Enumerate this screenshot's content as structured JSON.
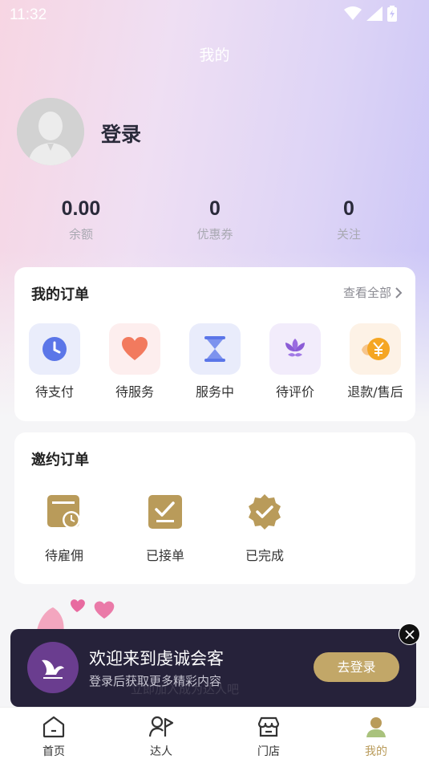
{
  "status_bar": {
    "time": "11:32"
  },
  "header": {
    "title": "我的"
  },
  "profile": {
    "login_label": "登录"
  },
  "stats": [
    {
      "value": "0.00",
      "label": "余额"
    },
    {
      "value": "0",
      "label": "优惠券"
    },
    {
      "value": "0",
      "label": "关注"
    }
  ],
  "my_orders": {
    "title": "我的订单",
    "view_all": "查看全部",
    "items": [
      {
        "label": "待支付",
        "icon": "clock-icon",
        "bg": "#eaedfb"
      },
      {
        "label": "待服务",
        "icon": "heart-icon",
        "bg": "#fdeeee"
      },
      {
        "label": "服务中",
        "icon": "hourglass-icon",
        "bg": "#e9ecfb"
      },
      {
        "label": "待评价",
        "icon": "flower-icon",
        "bg": "#f2ecfb"
      },
      {
        "label": "退款/售后",
        "icon": "yen-coin-icon",
        "bg": "#fdf2e6"
      }
    ]
  },
  "invite_orders": {
    "title": "邀约订单",
    "items": [
      {
        "label": "待雇佣",
        "icon": "calendar-clock-icon"
      },
      {
        "label": "已接单",
        "icon": "checkbox-icon"
      },
      {
        "label": "已完成",
        "icon": "verified-badge-icon"
      }
    ]
  },
  "promo": {
    "title": "欢迎来到虔诚会客",
    "subtitle": "登录后获取更多精彩内容",
    "ghost_text": "立即加入成为达人吧",
    "button": "去登录"
  },
  "tabbar": [
    {
      "label": "首页",
      "icon": "home-icon"
    },
    {
      "label": "达人",
      "icon": "person-flag-icon"
    },
    {
      "label": "门店",
      "icon": "store-icon"
    },
    {
      "label": "我的",
      "icon": "profile-icon",
      "active": true
    }
  ],
  "colors": {
    "accent_gold": "#b99b5a",
    "button_gold": "#c2a768",
    "promo_bg": "#26223a"
  }
}
